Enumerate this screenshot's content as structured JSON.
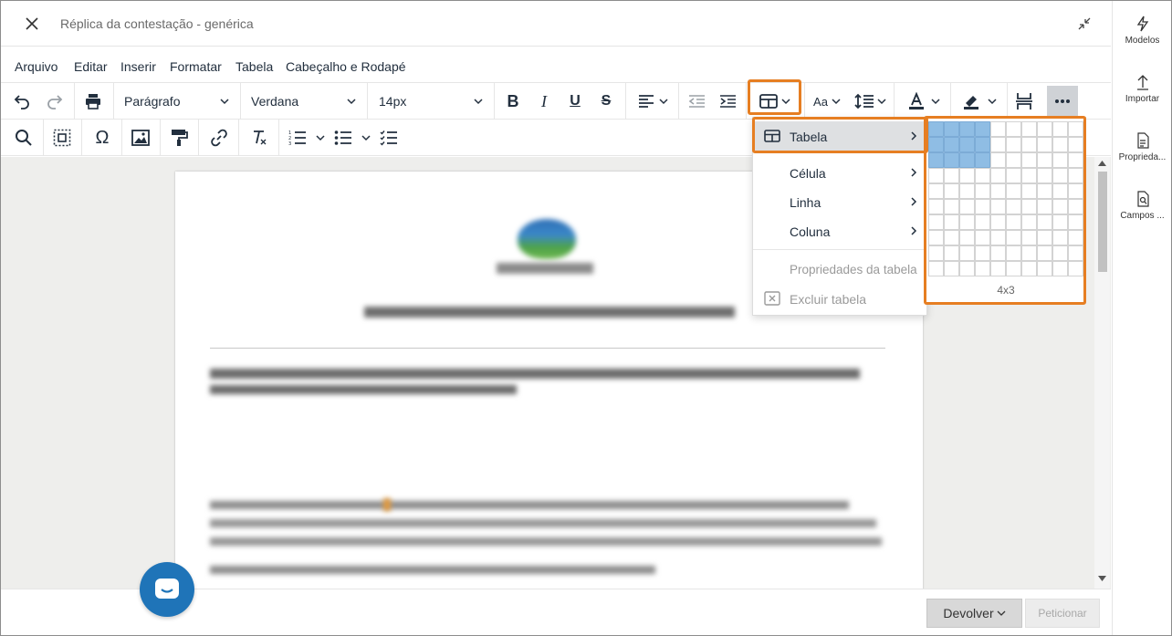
{
  "window": {
    "title": "Réplica da contestação - genérica",
    "close_icon": "close-icon",
    "collapse_icon": "collapse-icon"
  },
  "menubar": {
    "items": [
      "Arquivo",
      "Editar",
      "Inserir",
      "Formatar",
      "Tabela",
      "Cabeçalho e Rodapé"
    ]
  },
  "toolbar": {
    "block_format": "Parágrafo",
    "font_family": "Verdana",
    "font_size": "14px",
    "font_size_label": "Aa"
  },
  "table_menu": {
    "items": [
      {
        "label": "Tabela",
        "state": "active"
      },
      {
        "label": "Célula",
        "state": "normal"
      },
      {
        "label": "Linha",
        "state": "normal"
      },
      {
        "label": "Coluna",
        "state": "normal"
      },
      {
        "label": "Propriedades da tabela",
        "state": "disabled"
      },
      {
        "label": "Excluir tabela",
        "state": "disabled"
      }
    ]
  },
  "table_grid": {
    "columns": 10,
    "rows": 10,
    "selected_columns": 4,
    "selected_rows": 3,
    "size_label": "4x3"
  },
  "right_panel": {
    "items": [
      "Modelos",
      "Importar",
      "Propriedades",
      "Campos ..."
    ],
    "items_display": [
      "Modelos",
      "Importar",
      "Proprieda...",
      "Campos ..."
    ]
  },
  "footer": {
    "devolver_label": "Devolver",
    "peticionar_label": "Peticionar"
  },
  "colors": {
    "highlight": "#e67e22",
    "grid_selected": "#8fbde4",
    "chat_button": "#1f74b8"
  }
}
